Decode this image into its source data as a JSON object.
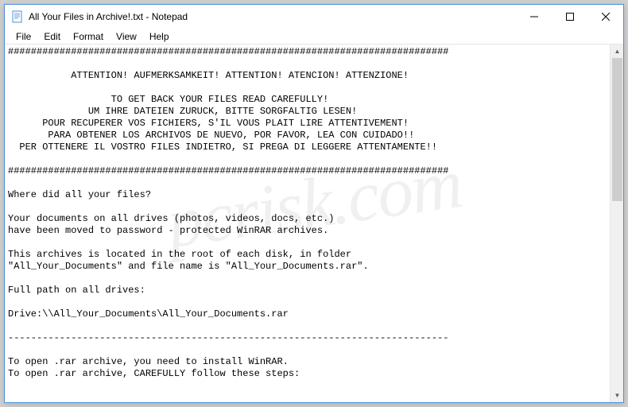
{
  "window": {
    "title": "All Your Files in Archive!.txt - Notepad"
  },
  "menu": {
    "file": "File",
    "edit": "Edit",
    "format": "Format",
    "view": "View",
    "help": "Help"
  },
  "content": {
    "text": "#############################################################################\n\n           ATTENTION! AUFMERKSAMKEIT! ATTENTION! ATENCION! ATTENZIONE!\n\n                  TO GET BACK YOUR FILES READ CAREFULLY!\n              UM IHRE DATEIEN ZURUCK, BITTE SORGFALTIG LESEN!\n      POUR RECUPERER VOS FICHIERS, S'IL VOUS PLAIT LIRE ATTENTIVEMENT!\n       PARA OBTENER LOS ARCHIVOS DE NUEVO, POR FAVOR, LEA CON CUIDADO!!\n  PER OTTENERE IL VOSTRO FILES INDIETRO, SI PREGA DI LEGGERE ATTENTAMENTE!!\n\n#############################################################################\n\nWhere did all your files?\n\nYour documents on all drives (photos, videos, docs, etc.)\nhave been moved to password - protected WinRAR archives.\n\nThis archives is located in the root of each disk, in folder\n\"All_Your_Documents\" and file name is \"All_Your_Documents.rar\".\n\nFull path on all drives:\n\nDrive:\\\\All_Your_Documents\\All_Your_Documents.rar\n\n-----------------------------------------------------------------------------\n\nTo open .rar archive, you need to install WinRAR.\nTo open .rar archive, CAREFULLY follow these steps:"
  },
  "watermark": "pcrisk.com"
}
